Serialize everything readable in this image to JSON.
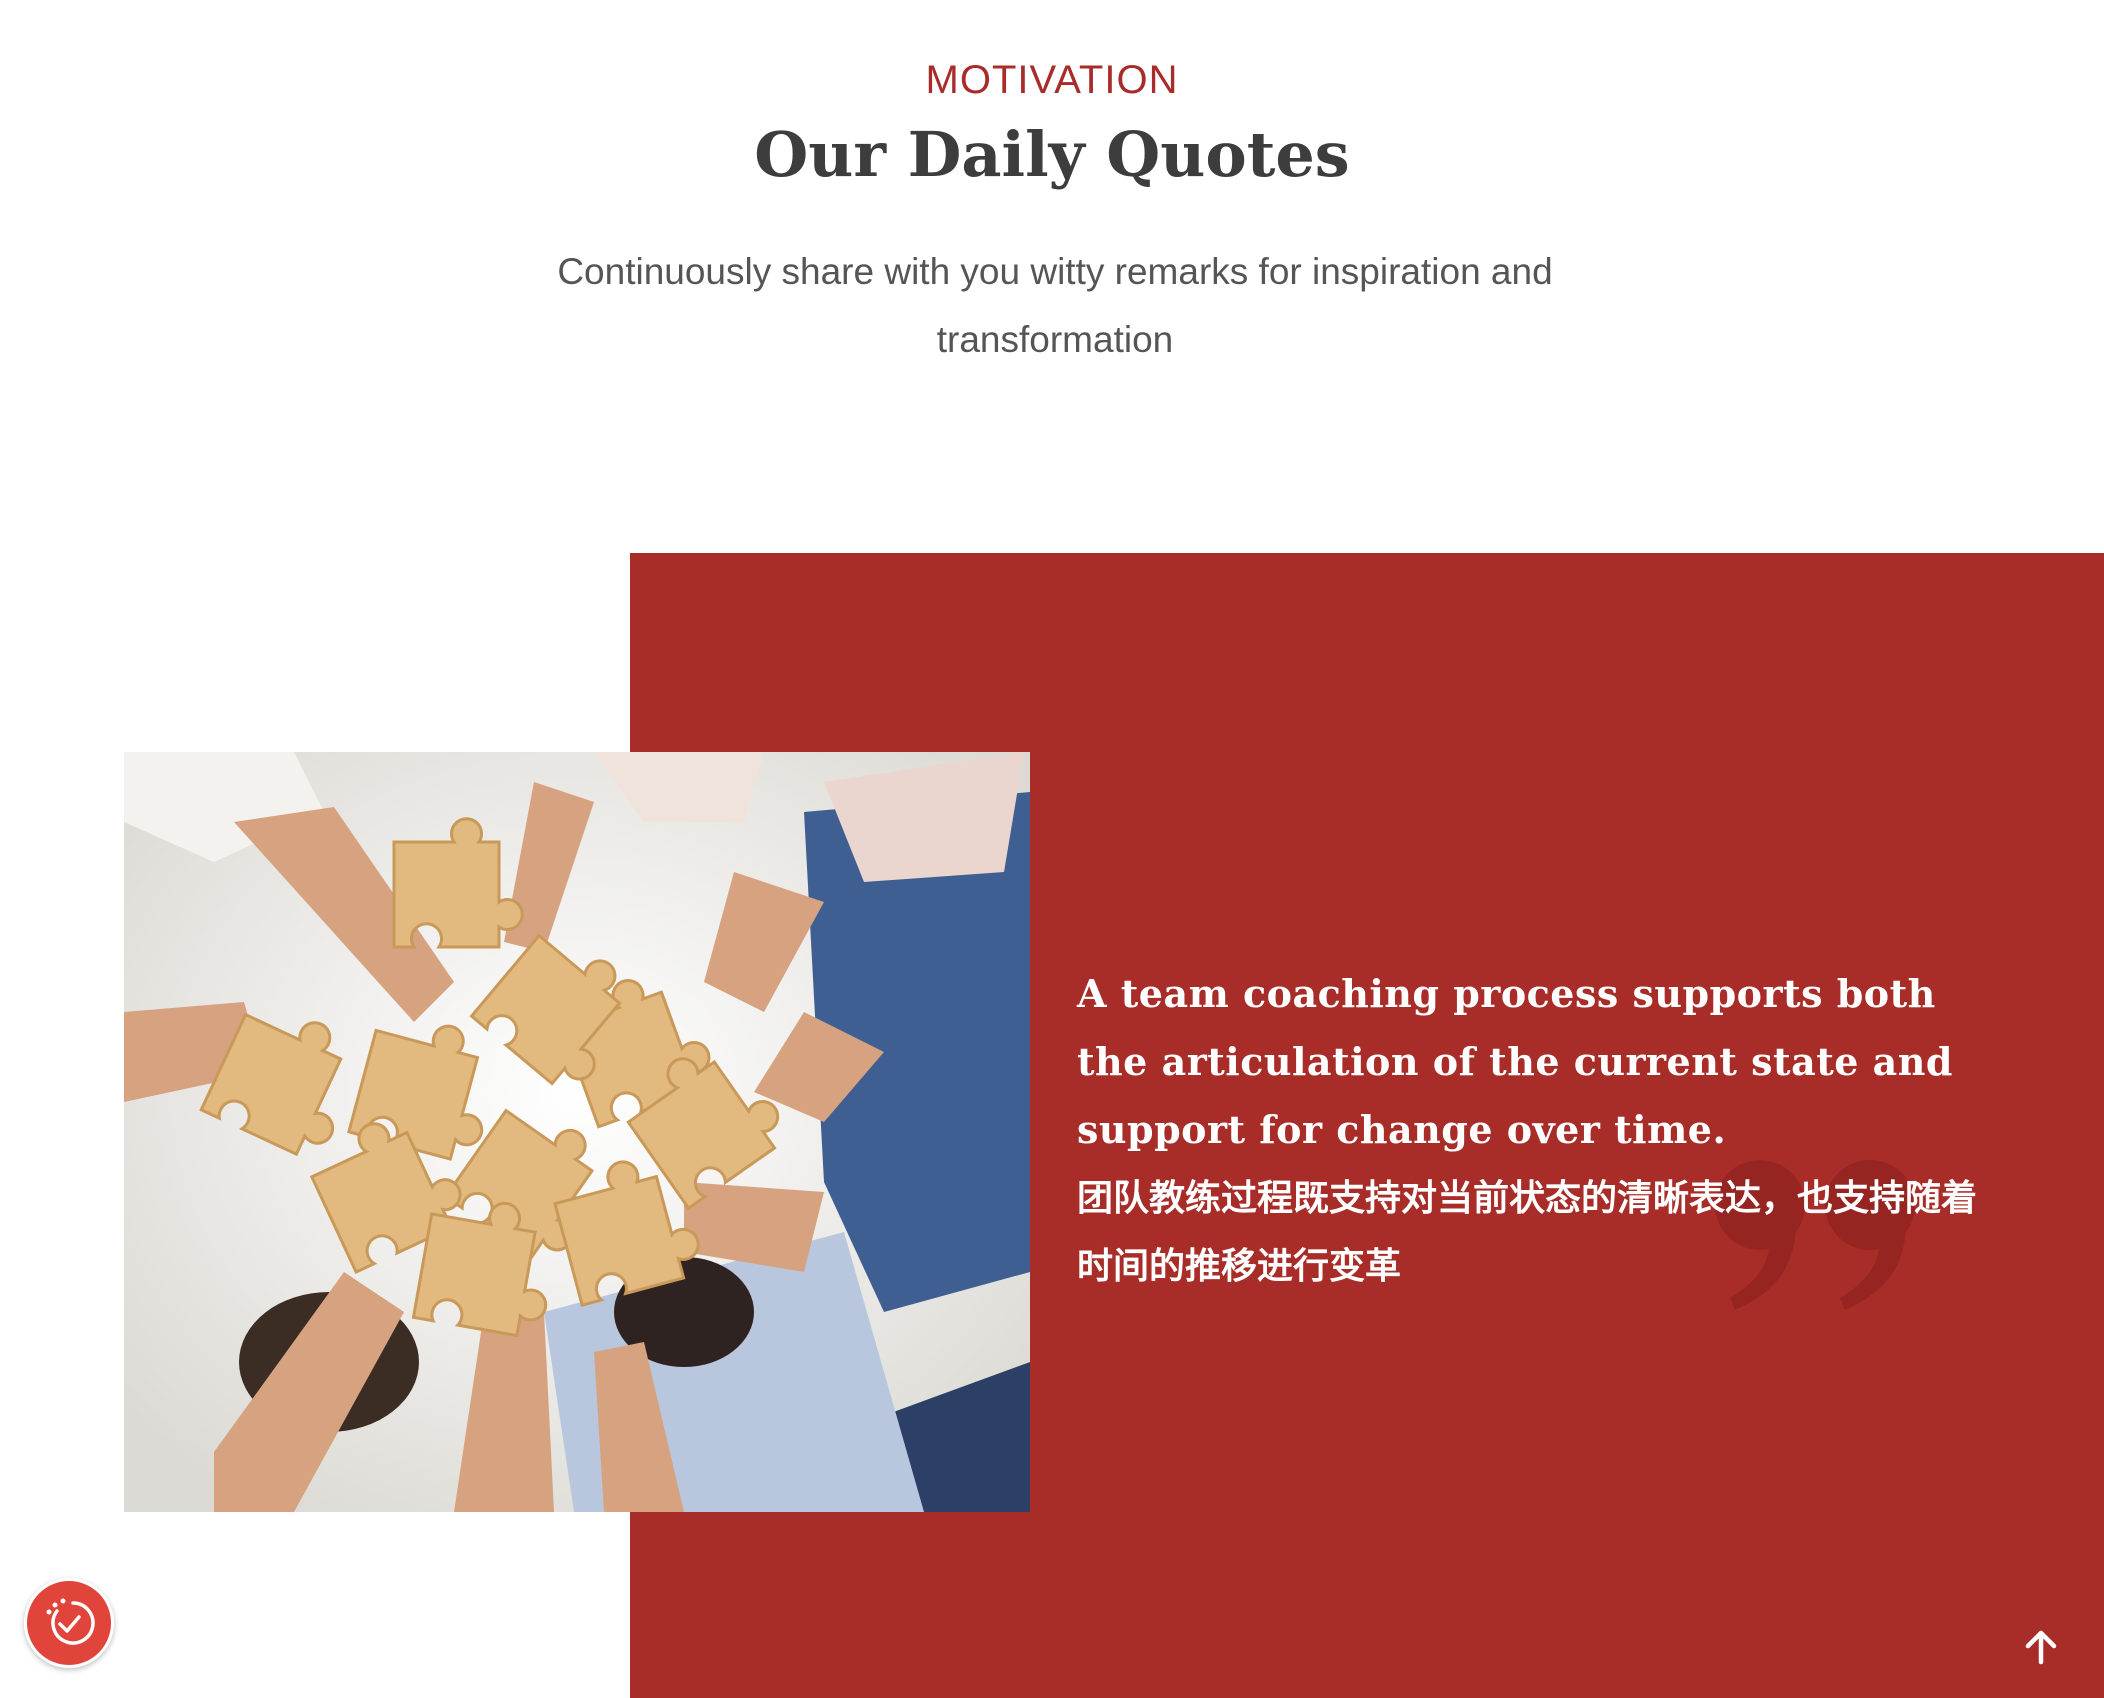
{
  "section": {
    "eyebrow": "MOTIVATION",
    "title": "Our Daily Quotes",
    "subtitle": "Continuously share with you witty remarks for inspiration and transformation"
  },
  "quote": {
    "text_en": "A team coaching process supports both the articulation of the current state and support for change over time.",
    "text_zh": "团队教练过程既支持对当前状态的清晰表达，也支持随着时间的推移进行变革",
    "quote_icon": "closing-quote-icon"
  },
  "image": {
    "icon": "team-puzzle-photo"
  },
  "controls": {
    "accessibility_icon": "accessibility-check-icon",
    "scroll_top_icon": "arrow-up-icon"
  },
  "colors": {
    "accent": "#a82c2a",
    "panel": "#a82c28",
    "heading": "#3d3d3d",
    "body": "#555555",
    "a11y_button": "#e0443a"
  }
}
